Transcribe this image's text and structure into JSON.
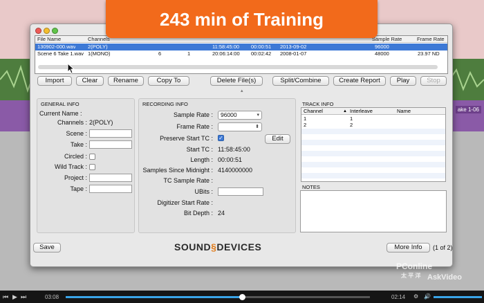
{
  "banner": {
    "text": "243 min of Training"
  },
  "window": {
    "file_list": {
      "columns": [
        "File Name",
        "Channels",
        "",
        "",
        "",
        "",
        "",
        "Sample Rate",
        "Frame Rate"
      ],
      "rows": [
        [
          "130902-000.wav",
          "2(POLY)",
          "",
          "",
          "11:58:45:00",
          "00:00:51",
          "2013-09-02",
          "96000",
          ""
        ],
        [
          "Scene 6  Take 1.wav",
          "1(MONO)",
          "6",
          "1",
          "20:06:14:00",
          "00:02:42",
          "2008-01-07",
          "48000",
          "23.97 ND"
        ]
      ]
    },
    "toolbar": {
      "import": "Import",
      "clear": "Clear",
      "rename": "Rename",
      "copy_to": "Copy To",
      "delete_files": "Delete File(s)",
      "split_combine": "Split/Combine",
      "create_report": "Create Report",
      "play": "Play",
      "stop": "Stop"
    },
    "general_info": {
      "title": "GENERAL INFO",
      "current_name_label": "Current Name :",
      "current_name_value": "",
      "channels_label": "Channels :",
      "channels_value": "2(POLY)",
      "scene_label": "Scene :",
      "take_label": "Take :",
      "circled_label": "Circled :",
      "wild_track_label": "Wild Track :",
      "project_label": "Project :",
      "tape_label": "Tape :"
    },
    "recording_info": {
      "title": "RECORDING INFO",
      "sample_rate_label": "Sample Rate :",
      "sample_rate_value": "96000",
      "frame_rate_label": "Frame Rate :",
      "frame_rate_value": "",
      "preserve_start_tc_label": "Preserve Start TC :",
      "preserve_start_tc_checked": true,
      "edit": "Edit",
      "start_tc_label": "Start TC :",
      "start_tc_value": "11:58:45:00",
      "length_label": "Length :",
      "length_value": "00:00:51",
      "samples_label": "Samples Since Midnight :",
      "samples_value": "4140000000",
      "tc_sample_rate_label": "TC Sample Rate :",
      "ubits_label": "UBits :",
      "digitizer_label": "Digitizer Start Rate :",
      "bit_depth_label": "Bit Depth :",
      "bit_depth_value": "24"
    },
    "track_info": {
      "title": "TRACK INFO",
      "columns": [
        "Channel",
        "Interleave",
        "Name"
      ],
      "rows": [
        [
          "1",
          "1",
          ""
        ],
        [
          "2",
          "2",
          ""
        ]
      ]
    },
    "notes": {
      "title": "NOTES"
    },
    "footer": {
      "save": "Save",
      "brand_left": "SOUND",
      "brand_right": "DEVICES",
      "more_info": "More Info",
      "page": "(1 of 2)"
    }
  },
  "daw": {
    "clip_name": "ake 1-06"
  },
  "video": {
    "current_time": "03:08",
    "total_time": "02:14",
    "progress": 0.58
  },
  "watermark": {
    "line1": "PConline",
    "line2": "太 平 洋",
    "line3": "AskVideo"
  },
  "colors": {
    "banner": "#f26a1b",
    "selection": "#3d79d6",
    "brand_accent": "#e07b1a"
  }
}
